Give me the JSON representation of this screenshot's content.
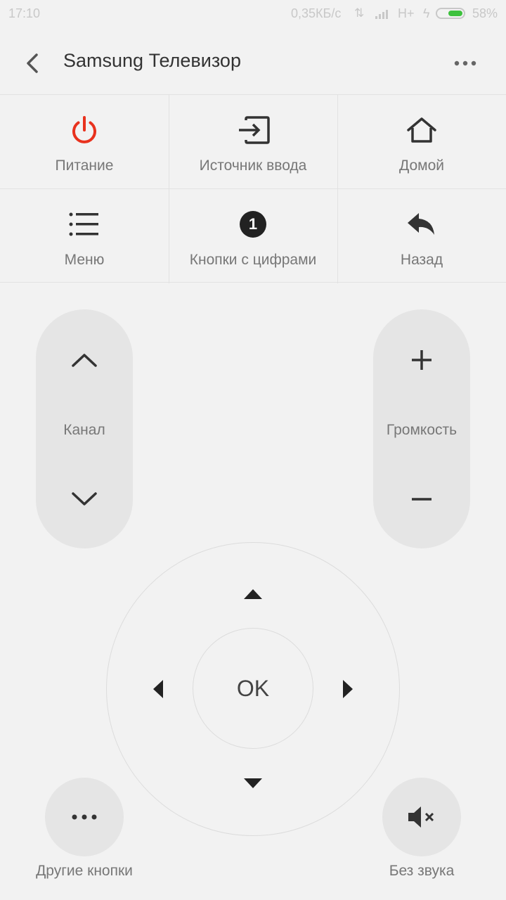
{
  "status_bar": {
    "time": "17:10",
    "network_speed": "0,35КБ/с",
    "network_type": "H+",
    "battery_percent": "58%",
    "battery_level": 0.58
  },
  "header": {
    "title": "Samsung Телевизор"
  },
  "grid": {
    "power_label": "Питание",
    "input_label": "Источник ввода",
    "home_label": "Домой",
    "menu_label": "Меню",
    "digits_label": "Кнопки с цифрами",
    "digits_icon_text": "1",
    "back_label": "Назад"
  },
  "controls": {
    "channel_label": "Канал",
    "volume_label": "Громкость",
    "ok_label": "OK",
    "other_label": "Другие кнопки",
    "mute_label": "Без звука"
  },
  "colors": {
    "power_accent": "#e8321e",
    "battery_fill": "#3cc13c"
  }
}
